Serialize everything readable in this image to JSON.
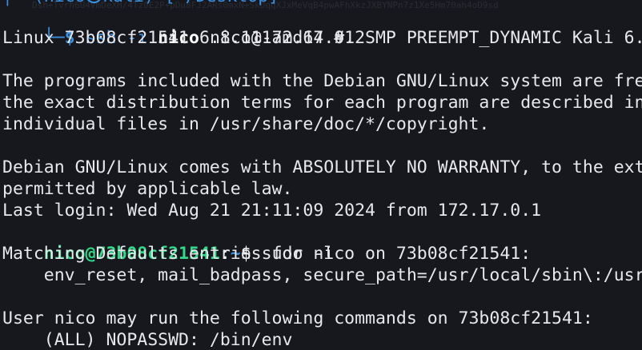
{
  "prompt_top": {
    "branch": "└─",
    "symbol": "$",
    "command": "ssh",
    "flag": "-i",
    "keyfile": "nico",
    "target": "nico@172.17.0.2"
  },
  "lines": [
    "Linux 73b08cf21541 6.8.11-amd64 #1 SMP PREEMPT_DYNAMIC Kali 6.",
    "",
    "The programs included with the Debian GNU/Linux system are fre",
    "the exact distribution terms for each program are described in",
    "individual files in /usr/share/doc/*/copyright.",
    "",
    "Debian GNU/Linux comes with ABSOLUTELY NO WARRANTY, to the ext",
    "permitted by applicable law.",
    "Last login: Wed Aug 21 21:11:09 2024 from 172.17.0.1"
  ],
  "shell_prompt": {
    "user_host": "nico@73b08cf21541",
    "sep": ":",
    "dir": "~",
    "symbol": "$",
    "command": " sudo -l"
  },
  "output": [
    "Matching Defaults entries for nico on 73b08cf21541:",
    "    env_reset, mail_badpass, secure_path=/usr/local/sbin\\:/usr",
    "",
    "User nico may run the following commands on 73b08cf21541:",
    "    (ALL) NOPASSWD: /bin/env"
  ]
}
